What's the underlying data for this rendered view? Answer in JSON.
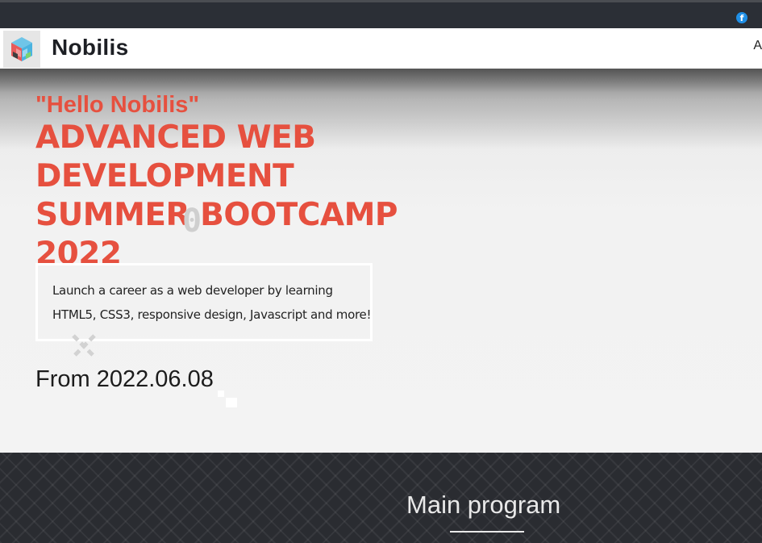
{
  "topbar": {
    "social_icon": "facebook-icon",
    "social_glyph": "f"
  },
  "navbar": {
    "brand": "Nobilis",
    "logo_icon": "cube-logo-icon",
    "nav_partial": "A"
  },
  "hero": {
    "hello": "\"Hello Nobilis\"",
    "headline_lines": [
      "ADVANCED WEB DEVELOPMENT",
      "SUMMER BOOTCAMP",
      "2022"
    ],
    "decor_glyph": "0",
    "description_lines": [
      "Launch a career as a web developer by learning",
      "HTML5, CSS3, responsive design, Javascript and more!"
    ],
    "from_date": "From 2022.06.08"
  },
  "program": {
    "title": "Main program"
  },
  "colors": {
    "accent": "#e6503f",
    "topbar": "#2b2f36",
    "dark_section": "#2a2c31"
  }
}
